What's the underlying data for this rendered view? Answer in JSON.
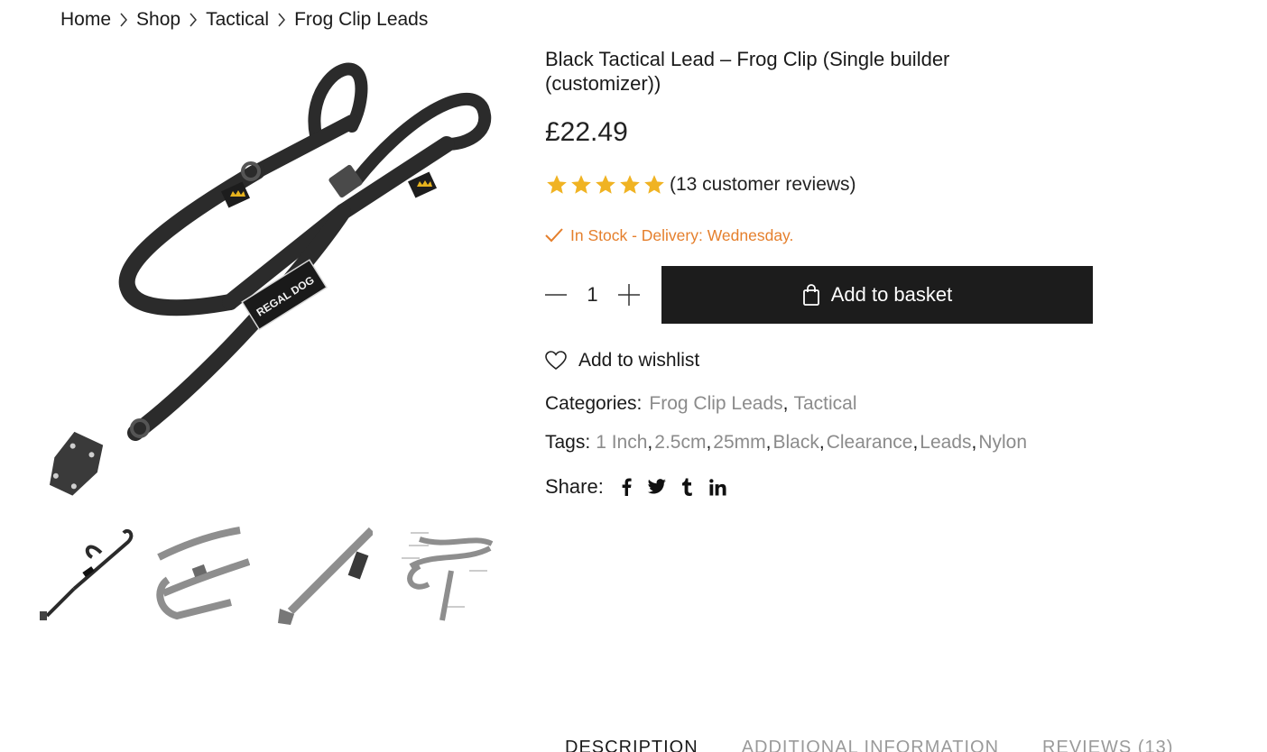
{
  "breadcrumb": {
    "items": [
      "Home",
      "Shop",
      "Tactical",
      "Frog Clip Leads"
    ]
  },
  "product": {
    "title": "Black Tactical Lead – Frog Clip (Single builder (customizer))",
    "price": "£22.49",
    "rating": 5,
    "rating_max": 5,
    "reviews_text": "(13 customer reviews)",
    "stock_text": "In Stock - Delivery: Wednesday.",
    "quantity": "1",
    "add_to_basket_label": "Add to basket",
    "wishlist_label": "Add to wishlist",
    "brand_print": "REGAL DOG"
  },
  "meta": {
    "categories_label": "Categories:",
    "categories": [
      "Frog Clip Leads",
      "Tactical"
    ],
    "tags_label": "Tags:",
    "tags": [
      "1 Inch",
      "2.5cm",
      "25mm",
      "Black",
      "Clearance",
      "Leads",
      "Nylon"
    ],
    "share_label": "Share:",
    "share_icons": [
      "facebook-icon",
      "twitter-icon",
      "tumblr-icon",
      "linkedin-icon"
    ]
  },
  "tabs": [
    "DESCRIPTION",
    "ADDITIONAL INFORMATION",
    "REVIEWS (13)"
  ],
  "colors": {
    "star": "#f0b323",
    "stock": "#e57f2c",
    "button_bg": "#1c1c1c",
    "link_gray": "#8b8b8b",
    "lead_black": "#2b2b2b"
  }
}
